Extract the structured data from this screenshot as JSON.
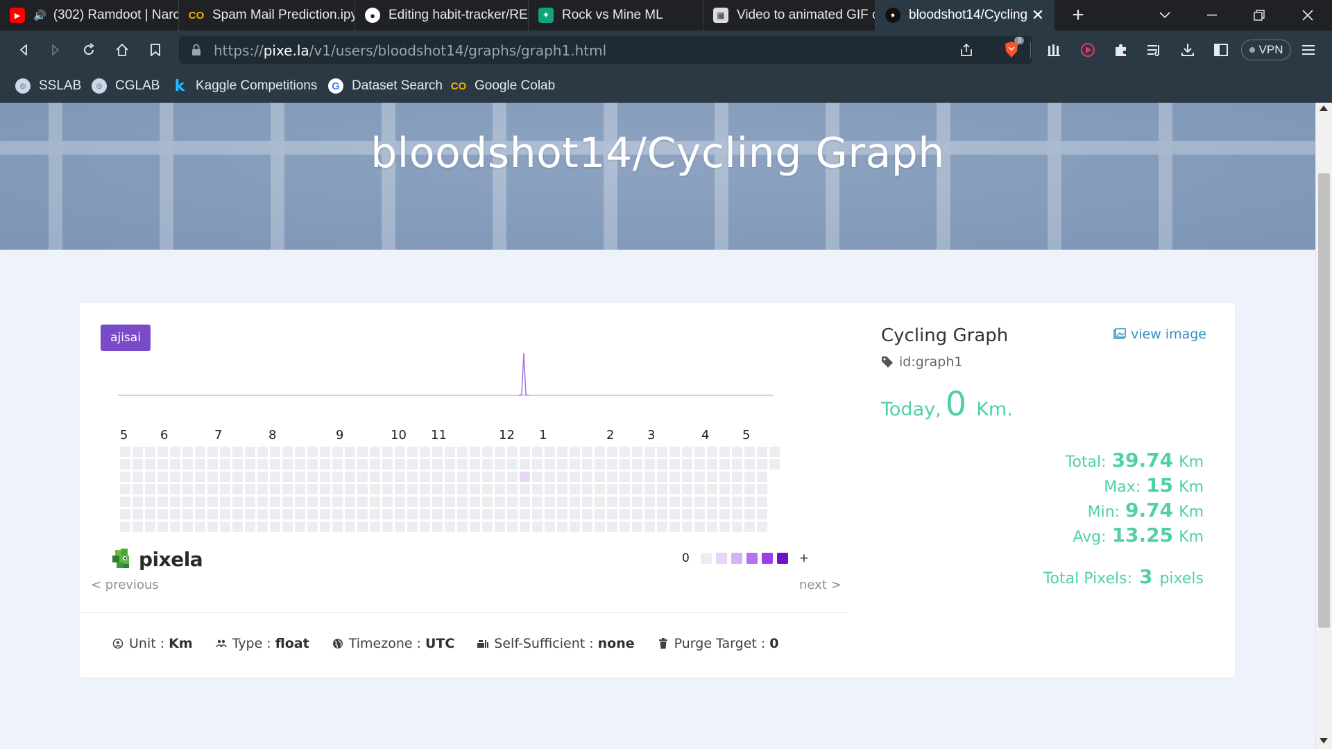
{
  "browser": {
    "tabs": [
      {
        "label": "(302) Ramdoot | Narc",
        "icon": "youtube-icon"
      },
      {
        "label": "Spam Mail Prediction.ipy",
        "icon": "colab-icon"
      },
      {
        "label": "Editing habit-tracker/RE/",
        "icon": "github-icon"
      },
      {
        "label": "Rock vs Mine ML",
        "icon": "chatgpt-icon"
      },
      {
        "label": "Video to animated GIF c",
        "icon": "converter-icon"
      },
      {
        "label": "bloodshot14/Cycling",
        "icon": "pixela-icon",
        "active": true
      }
    ],
    "url_prefix": "https://",
    "url_host": "pixe.la",
    "url_path": "/v1/users/bloodshot14/graphs/graph1.html",
    "brave_badge": "3",
    "vpn_label": "VPN",
    "bookmarks": [
      {
        "label": "SSLAB",
        "icon": "sslab-icon"
      },
      {
        "label": "CGLAB",
        "icon": "cglab-icon"
      },
      {
        "label": "Kaggle Competitions",
        "icon": "kaggle-icon"
      },
      {
        "label": "Dataset Search",
        "icon": "google-icon"
      },
      {
        "label": "Google Colab",
        "icon": "colab-icon"
      }
    ]
  },
  "page": {
    "title": "bloodshot14/Cycling Graph",
    "theme": "ajisai",
    "months": [
      "5",
      "6",
      "7",
      "8",
      "9",
      "10",
      "11",
      "12",
      "1",
      "2",
      "3",
      "4",
      "5"
    ],
    "legend_min": "0",
    "legend_max": "+",
    "legend_colors": [
      "#ebedf0",
      "#e6d6f8",
      "#d3b3f5",
      "#b472ee",
      "#9b3fe6",
      "#6e11c7"
    ],
    "logo_text": "pixela",
    "previous": "< previous",
    "next": "next >",
    "props": [
      {
        "icon": "unit-icon",
        "label": "Unit",
        "value": "Km"
      },
      {
        "icon": "type-icon",
        "label": "Type",
        "value": "float"
      },
      {
        "icon": "globe-icon",
        "label": "Timezone",
        "value": "UTC"
      },
      {
        "icon": "self-sufficient-icon",
        "label": "Self-Sufficient",
        "value": "none"
      },
      {
        "icon": "trash-icon",
        "label": "Purge Target",
        "value": "0"
      }
    ],
    "prop_separator": ":",
    "info": {
      "title": "Cycling Graph",
      "id_text": "id:graph1",
      "view_image": "view image",
      "today_label": "Today,",
      "today_value": "0",
      "today_unit": "Km.",
      "stats": [
        {
          "label": "Total:",
          "value": "39.74",
          "unit": "Km"
        },
        {
          "label": "Max:",
          "value": "15",
          "unit": "Km"
        },
        {
          "label": "Min:",
          "value": "9.74",
          "unit": "Km"
        },
        {
          "label": "Avg:",
          "value": "13.25",
          "unit": "Km"
        }
      ],
      "total_pixels_label": "Total Pixels:",
      "total_pixels_value": "3",
      "total_pixels_unit": "pixels"
    },
    "accent_color": "#4fd0a9",
    "heatmap_weeks": 53,
    "heatmap_active_week": 32,
    "heatmap_active_days": [
      2,
      7
    ]
  }
}
